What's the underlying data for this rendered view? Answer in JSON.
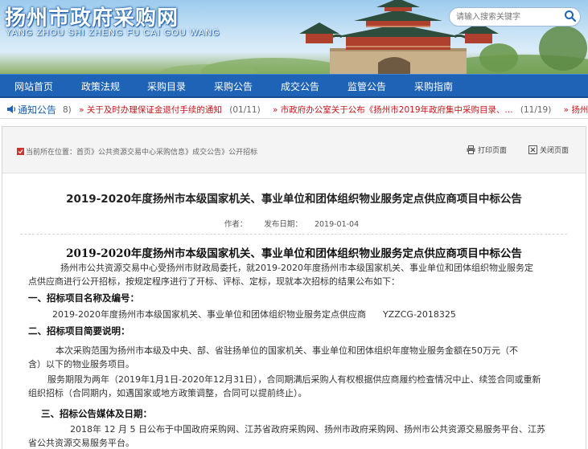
{
  "site": {
    "title": "扬州市政府采购网",
    "pinyin": "YANG ZHOU SHI ZHENG FU CAI GOU WANG"
  },
  "search": {
    "placeholder": "请输入搜索关键字"
  },
  "nav": {
    "items": [
      "网站首页",
      "政策法规",
      "采购目录",
      "采购公告",
      "成交公告",
      "监管公告",
      "采购指南"
    ]
  },
  "notice": {
    "label": "通知公告",
    "items": [
      {
        "text": "8)",
        "date": ""
      },
      {
        "text": "关于及时办理保证金退付手续的通知",
        "date": "(01/11)"
      },
      {
        "text": "市政府办公室关于公布《扬州市2019年政府集中采购目录、...",
        "date": "(11/19)"
      },
      {
        "text": "扬州市财政局关",
        "date": ""
      }
    ]
  },
  "breadcrumb": {
    "prefix": "当前所在位置：",
    "items": [
      "首页",
      "公共资源交易中心采购信息",
      "成交公告",
      "公开招标"
    ],
    "sep": "》"
  },
  "tools": {
    "print": "打印页面",
    "close": "关闭页面"
  },
  "page_title": "2019-2020年度扬州市本级国家机关、事业单位和团体组织物业服务定点供应商项目中标公告",
  "meta": {
    "author_label": "作者：",
    "date_label": "发布日期：",
    "date": "2019-01-04"
  },
  "article": {
    "title": "2019-2020年度扬州市本级国家机关、事业单位和团体组织物业服务定点供应商项目中标公告",
    "intro_line1": "扬州市公共资源交易中心受扬州市财政局委托，就2019-2020年度扬州市本级国家机关、事业单位和团体组织物业服务定",
    "intro_line2": "点供应商进行公开招标，按规定程序进行了开标、评标、定标，现就本次招标的结果公布如下：",
    "h1": "一、招标项目名称及编号：",
    "project_name": "2019-2020年度扬州市本级国家机关、事业单位和团体组织物业服务定点供应商",
    "project_code": "YZZCG-2018325",
    "h2": "二、招标项目简要说明：",
    "desc_line1": "本次采购范围为扬州市本级及中央、部、省驻扬单位的国家机关、事业单位和团体组织年度物业服务金额在50万元（不",
    "desc_line2": "含）以下的物业服务项目。",
    "term_line1": "服务期限为两年（2019年1月1日-2020年12月31日），合同期满后采购人有权根据供应商履约检查情况中止、续签合同或重新",
    "term_line2": "组织招标（合同期内，如遇国家或地方政策调整，合同可以提前终止）。",
    "h3": "三、招标公告媒体及日期：",
    "media_line1": "2018年 12 月 5 日公布于中国政府采购网、江苏省政府采购网、扬州市政府采购网、扬州市公共资源交易服务平台、江苏",
    "media_line2": "省公共资源交易服务平台。"
  }
}
